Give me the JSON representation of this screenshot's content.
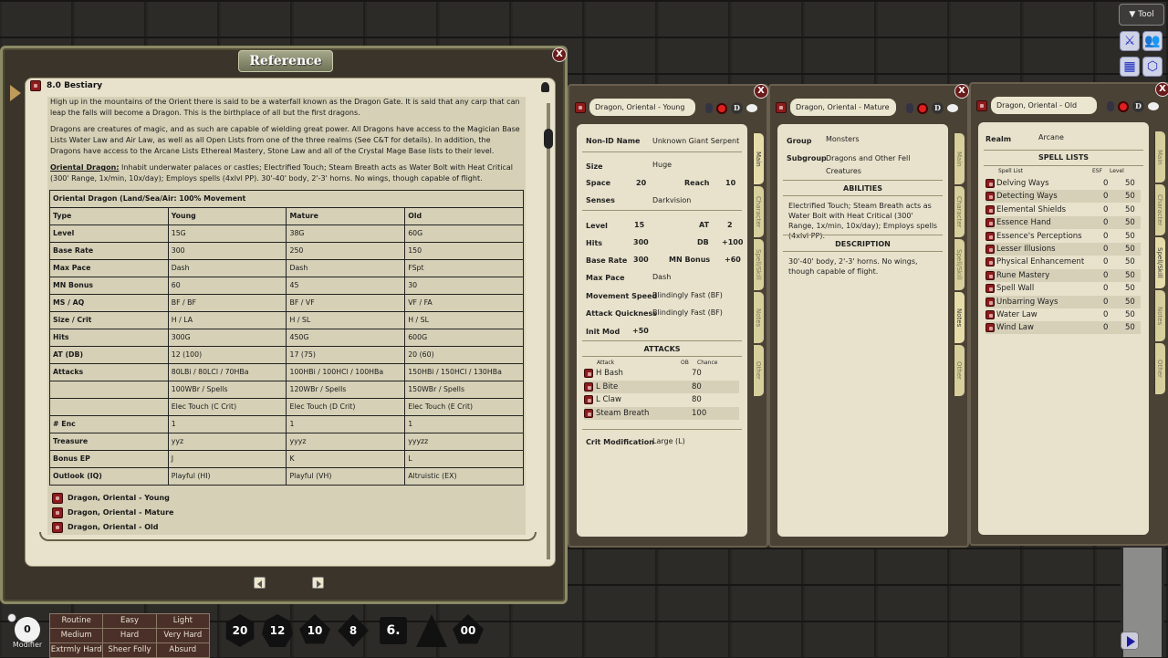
{
  "reference": {
    "title": "Reference",
    "close_label": "X",
    "section_title": "8.0 Bestiary",
    "paragraphs": [
      "High up in the mountains of the Orient there is said to be a waterfall known as the Dragon Gate. It is said that any carp that can leap the falls will become a Dragon. This is the birthplace of all but the first dragons.",
      "Dragons are creatures of magic, and as such are capable of wielding great power. All Dragons have access to the Magician Base Lists Water Law and Air Law, as well as all Open Lists from one of the three realms (See C&T for details). In addition, the Dragons have access to the Arcane Lists Ethereal Mastery, Stone Law and all of the Crystal Mage Base lists to their level."
    ],
    "oriental_label": "Oriental Dragon:",
    "oriental_text": " Inhabit underwater palaces or castles; Electrified Touch; Steam Breath acts as Water Bolt with Heat Critical (300' Range, 1x/min, 10x/day); Employs spells (4xlvl PP). 30'-40' body, 2'-3' horns. No wings, though capable of flight.",
    "table": {
      "caption": "Oriental Dragon (Land/Sea/Air: 100% Movement",
      "rows": [
        [
          "Type",
          "Young",
          "Mature",
          "Old"
        ],
        [
          "Level",
          "15G",
          "38G",
          "60G"
        ],
        [
          "Base Rate",
          "300",
          "250",
          "150"
        ],
        [
          "Max Pace",
          "Dash",
          "Dash",
          "FSpt"
        ],
        [
          "MN Bonus",
          "60",
          "45",
          "30"
        ],
        [
          "MS / AQ",
          "BF / BF",
          "BF / VF",
          "VF / FA"
        ],
        [
          "Size / Crit",
          "H / LA",
          "H / SL",
          "H / SL"
        ],
        [
          "Hits",
          "300G",
          "450G",
          "600G"
        ],
        [
          "AT (DB)",
          "12 (100)",
          "17 (75)",
          "20 (60)"
        ],
        [
          "Attacks",
          "80LBi / 80LCl / 70HBa",
          "100HBi / 100HCl / 100HBa",
          "150HBi / 150HCl / 130HBa"
        ],
        [
          "",
          "100WBr / Spells",
          "120WBr / Spells",
          "150WBr / Spells"
        ],
        [
          "",
          "Elec Touch (C Crit)",
          "Elec Touch (D Crit)",
          "Elec Touch (E Crit)"
        ],
        [
          "# Enc",
          "1",
          "1",
          "1"
        ],
        [
          "Treasure",
          "yyz",
          "yyyz",
          "yyyzz"
        ],
        [
          "Bonus EP",
          "J",
          "K",
          "L"
        ],
        [
          "Outlook (IQ)",
          "Playful (HI)",
          "Playful (VH)",
          "Altruistic (EX)"
        ]
      ]
    },
    "links": [
      "Dragon, Oriental - Young",
      "Dragon, Oriental - Mature",
      "Dragon, Oriental - Old"
    ]
  },
  "sheet_young": {
    "name": "Dragon, Oriental - Young",
    "non_id_label": "Non-ID Name",
    "non_id": "Unknown Giant Serpent",
    "size_label": "Size",
    "size": "Huge",
    "space_label": "Space",
    "space": "20",
    "reach_label": "Reach",
    "reach": "10",
    "senses_label": "Senses",
    "senses": "Darkvision",
    "level_label": "Level",
    "level": "15",
    "at_label": "AT",
    "at": "2",
    "hits_label": "Hits",
    "hits": "300",
    "db_label": "DB",
    "db": "+100",
    "base_rate_label": "Base Rate",
    "base_rate": "300",
    "mn_label": "MN Bonus",
    "mn": "+60",
    "max_pace_label": "Max Pace",
    "max_pace": "Dash",
    "ms_label": "Movement Speed",
    "ms": "Blindingly Fast (BF)",
    "aq_label": "Attack Quickness",
    "aq": "Blindingly Fast (BF)",
    "init_label": "Init Mod",
    "init": "+50",
    "attacks_title": "ATTACKS",
    "attack_cols": [
      "Attack",
      "OB",
      "Chance"
    ],
    "attacks": [
      {
        "name": "H Bash",
        "ob": "70"
      },
      {
        "name": "L Bite",
        "ob": "80"
      },
      {
        "name": "L Claw",
        "ob": "80"
      },
      {
        "name": "Steam Breath",
        "ob": "100"
      }
    ],
    "crit_label": "Crit Modification",
    "crit": "Large (L)",
    "tabs": [
      "Main",
      "Character",
      "Spell/Skill",
      "Notes",
      "Other"
    ]
  },
  "sheet_mature": {
    "name": "Dragon, Oriental - Mature",
    "group_label": "Group",
    "group": "Monsters",
    "subgroup_label": "Subgroup",
    "subgroup": "Dragons and Other Fell Creatures",
    "abilities_title": "ABILITIES",
    "abilities": "Electrified Touch; Steam Breath acts as Water Bolt with Heat Critical (300' Range, 1x/min, 10x/day); Employs spells (4xlvl PP).",
    "description_title": "DESCRIPTION",
    "description": "30'-40' body, 2'-3' horns. No wings, though capable of flight.",
    "tabs": [
      "Main",
      "Character",
      "Spell/Skill",
      "Notes",
      "Other"
    ]
  },
  "sheet_old": {
    "name": "Dragon, Oriental - Old",
    "realm_label": "Realm",
    "realm": "Arcane",
    "spell_lists_title": "SPELL LISTS",
    "spell_cols": [
      "Spell List",
      "ESF",
      "Level"
    ],
    "spells": [
      {
        "name": "Delving Ways",
        "esf": "0",
        "level": "50"
      },
      {
        "name": "Detecting Ways",
        "esf": "0",
        "level": "50"
      },
      {
        "name": "Elemental Shields",
        "esf": "0",
        "level": "50"
      },
      {
        "name": "Essence Hand",
        "esf": "0",
        "level": "50"
      },
      {
        "name": "Essence's Perceptions",
        "esf": "0",
        "level": "50"
      },
      {
        "name": "Lesser Illusions",
        "esf": "0",
        "level": "50"
      },
      {
        "name": "Physical Enhancement",
        "esf": "0",
        "level": "50"
      },
      {
        "name": "Rune Mastery",
        "esf": "0",
        "level": "50"
      },
      {
        "name": "Spell Wall",
        "esf": "0",
        "level": "50"
      },
      {
        "name": "Unbarring Ways",
        "esf": "0",
        "level": "50"
      },
      {
        "name": "Water Law",
        "esf": "0",
        "level": "50"
      },
      {
        "name": "Wind Law",
        "esf": "0",
        "level": "50"
      }
    ],
    "tabs": [
      "Main",
      "Character",
      "Spell/Skill",
      "Notes",
      "Other"
    ]
  },
  "header_icons": {
    "d": "D"
  },
  "toolbar": {
    "tool_label": "▼ Tool",
    "icons": [
      "⚔",
      "👥",
      "▦",
      "⬡"
    ]
  },
  "bottom": {
    "modifier_value": "0",
    "modifier_label": "Modifier",
    "difficulty": [
      "Routine",
      "Easy",
      "Light",
      "Medium",
      "Hard",
      "Very Hard",
      "Extrmly Hard",
      "Sheer Folly",
      "Absurd"
    ],
    "dice": [
      "20",
      "12",
      "10",
      "8",
      "6.",
      "",
      "00"
    ]
  },
  "colors": {
    "accent_red": "#8e1b1b",
    "parchment": "#e8e2cc",
    "tool_blue": "#1d2bbf"
  }
}
